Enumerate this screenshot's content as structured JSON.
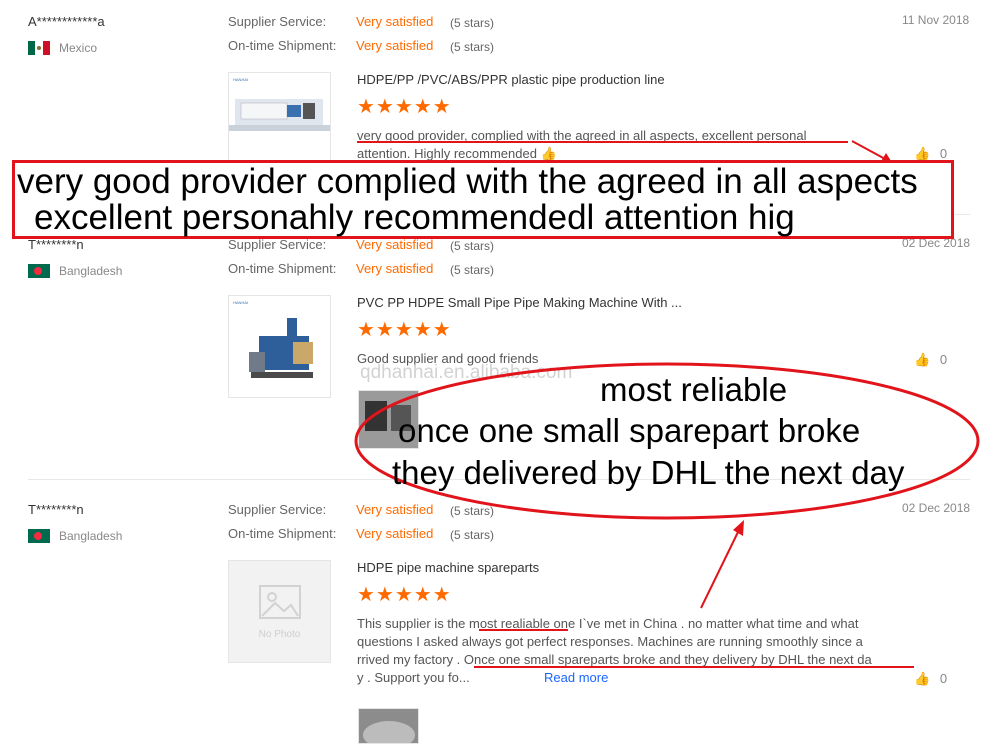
{
  "labels": {
    "supplier_service": "Supplier Service:",
    "ontime_shipment": "On-time Shipment:",
    "like_count": "0"
  },
  "reviews": [
    {
      "buyer": "A************a",
      "country": "Mexico",
      "date": "11 Nov 2018",
      "supplier_rating": "Very satisfied",
      "supplier_stars": "(5 stars)",
      "shipment_rating": "Very satisfied",
      "shipment_stars": "(5 stars)",
      "product_title": "HDPE/PP /PVC/ABS/PPR plastic pipe production line",
      "stars": 5,
      "text_line1": "very good provider, complied with the agreed in all aspects, excellent personal",
      "text_line2": "attention. Highly recommended 👍"
    },
    {
      "buyer": "T********n",
      "country": "Bangladesh",
      "date": "02 Dec 2018",
      "supplier_rating": "Very satisfied",
      "supplier_stars": "(5 stars)",
      "shipment_rating": "Very satisfied",
      "shipment_stars": "(5 stars)",
      "product_title": "PVC PP HDPE Small Pipe Pipe Making Machine With ...",
      "stars": 5,
      "text_line1": "Good supplier and good friends"
    },
    {
      "buyer": "T********n",
      "country": "Bangladesh",
      "date": "02 Dec 2018",
      "supplier_rating": "Very satisfied",
      "supplier_stars": "(5 stars)",
      "shipment_rating": "Very satisfied",
      "shipment_stars": "(5 stars)",
      "product_title": "HDPE pipe machine spareparts",
      "stars": 5,
      "no_photo": "No Photo",
      "text_line1_a": "This supplier is the ",
      "text_line1_b": "most realiable",
      "text_line1_c": " one I`ve met in China . no matter what time and what",
      "text_line2": "questions I asked always got perfect responses. Machines are running smoothly since a",
      "text_line3_a": "rrived my factory . ",
      "text_line3_b": "Once one small spareparts broke and they delivery by DHL the next da",
      "text_line4": "y . Support you fo...",
      "read_more": "Read more"
    }
  ],
  "watermark": "qdhanhai.en.alibaba.com",
  "annotations": {
    "box_line1": "very good provider complied with the agreed in all aspects",
    "box_line2": "excellent personahly recommendedl attention hig",
    "oval_line1": "most reliable",
    "oval_line2": "once one small sparepart broke",
    "oval_line3": "they delivered by DHL the next day"
  },
  "colors": {
    "accent_orange": "#ff6a00",
    "annotation_red": "#e0141a",
    "link_blue": "#1a66ff"
  }
}
